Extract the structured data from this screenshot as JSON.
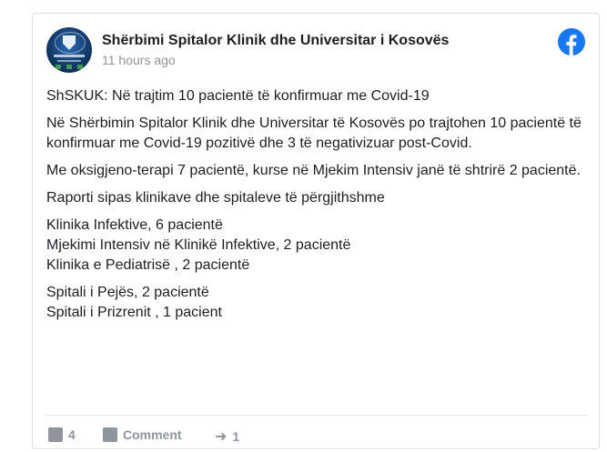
{
  "post": {
    "author": "Shërbimi Spitalor Klinik dhe Universitar i Kosovës",
    "time": "11 hours ago",
    "paragraphs": [
      "ShSKUK: Në trajtim 10 pacientë të konfirmuar me Covid-19",
      "Në Shërbimin Spitalor Klinik dhe Universitar të Kosovës po trajtohen 10 pacientë të konfirmuar me Covid-19 pozitivë dhe 3 të negativizuar post-Covid.",
      "Me oksigjeno-terapi 7 pacientë, kurse në Mjekim Intensiv janë të shtrirë 2 pacientë.",
      "Raporti sipas klinikave dhe spitaleve të përgjithshme"
    ],
    "clinics": [
      "Klinika Infektive, 6 pacientë",
      "Mjekimi Intensiv në Klinikë Infektive, 2 pacientë",
      "Klinika e Pediatrisë , 2 pacientë"
    ],
    "hospitals": [
      "Spitali i Pejës, 2 pacientë",
      "Spitali i Prizrenit , 1 pacient"
    ]
  },
  "footer": {
    "like_count": "4",
    "comment_label": "Comment",
    "share_count": "1"
  },
  "icons": {
    "platform": "facebook-icon",
    "avatar": "hospital-logo"
  },
  "colors": {
    "facebook_blue": "#1877f2",
    "text": "#1c1e21",
    "muted": "#90949c"
  }
}
